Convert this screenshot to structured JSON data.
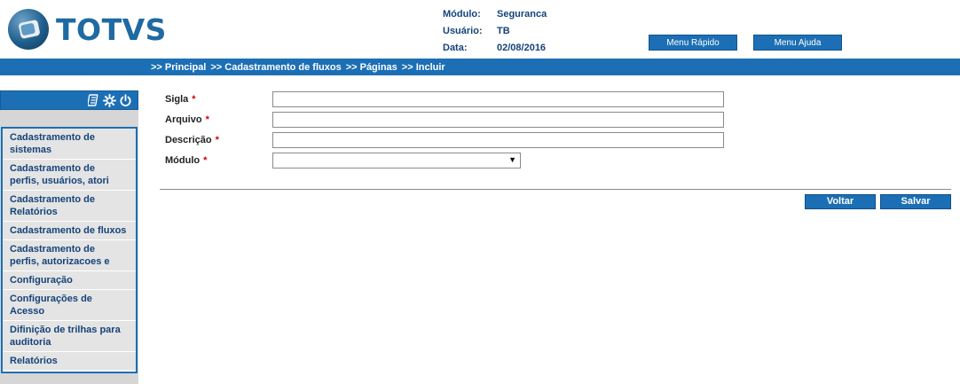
{
  "brand": {
    "name": "TOTVS"
  },
  "info": {
    "modulo_label": "Módulo:",
    "modulo_value": "Seguranca",
    "usuario_label": "Usuário:",
    "usuario_value": "TB",
    "data_label": "Data:",
    "data_value": "02/08/2016"
  },
  "top_buttons": {
    "rapido": "Menu Rápido",
    "ajuda": "Menu Ajuda"
  },
  "breadcrumb": [
    ">> Principal",
    ">> Cadastramento de fluxos",
    ">> Páginas",
    ">> Incluir"
  ],
  "sidebar": {
    "icons": [
      "calculator-icon",
      "gear-icon",
      "power-icon"
    ],
    "items": [
      {
        "l1": "Cadastramento de",
        "l2": "sistemas"
      },
      {
        "l1": "Cadastramento de",
        "l2": "perfis, usuários, atori"
      },
      {
        "l1": "Cadastramento de",
        "l2": "Relatórios"
      },
      {
        "l1": "Cadastramento de fluxos",
        "l2": ""
      },
      {
        "l1": "Cadastramento de",
        "l2": "perfis, autorizacoes e"
      },
      {
        "l1": "Configuração",
        "l2": ""
      },
      {
        "l1": "Configurações de",
        "l2": "Acesso"
      },
      {
        "l1": "Difinição de trilhas para",
        "l2": "auditoria"
      },
      {
        "l1": "Relatórios",
        "l2": ""
      }
    ]
  },
  "form": {
    "sigla_label": "Sigla",
    "sigla_value": "",
    "arquivo_label": "Arquivo",
    "arquivo_value": "",
    "descricao_label": "Descrição",
    "descricao_value": "",
    "modulo_label": "Módulo",
    "modulo_selected": "",
    "required_mark": "*"
  },
  "actions": {
    "voltar": "Voltar",
    "salvar": "Salvar"
  },
  "colors": {
    "primary": "#1c6fb5",
    "dark_text": "#14437a",
    "required": "#d00000",
    "sidebar_bg": "#d6d6d6"
  }
}
